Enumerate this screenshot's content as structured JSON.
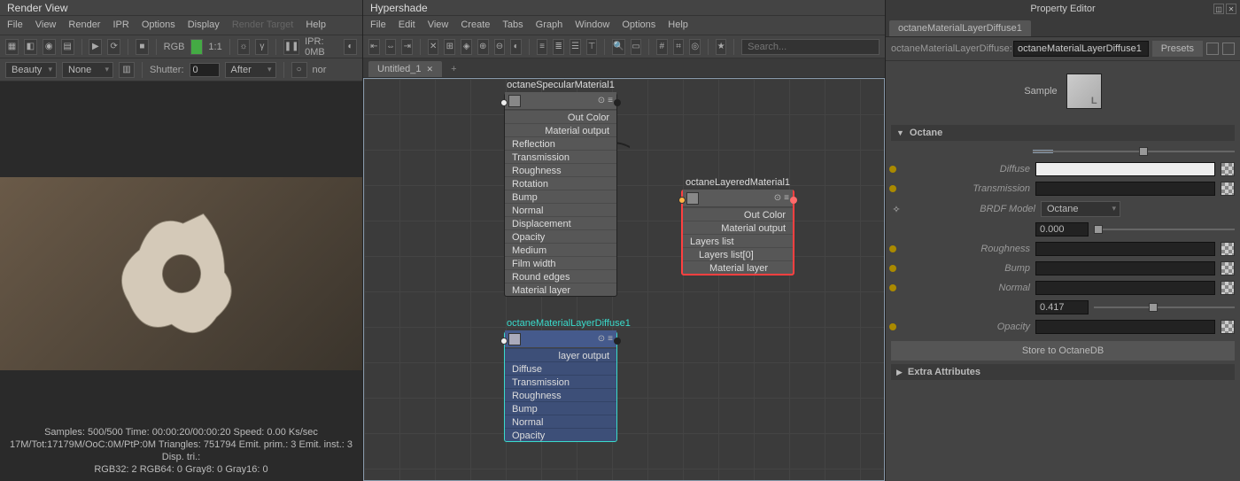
{
  "render_view": {
    "title": "Render View",
    "menu": [
      "File",
      "View",
      "Render",
      "IPR",
      "Options",
      "Display",
      "Render Target",
      "Help"
    ],
    "ipr_label": "IPR: 0MB",
    "rgb_label": "RGB",
    "ratio_label": "1:1",
    "row2": {
      "beauty": "Beauty",
      "none": "None",
      "shutter_label": "Shutter:",
      "shutter_val": "0",
      "after": "After",
      "nor": "nor"
    },
    "stats1": "Samples: 500/500 Time: 00:00:20/00:00:20 Speed: 0.00 Ks/sec",
    "stats2": "17M/Tot:17179M/OoC:0M/PtP:0M Triangles: 751794 Emit. prim.: 3 Emit. inst.: 3 Disp. tri.:",
    "stats3": "RGB32: 2 RGB64: 0 Gray8: 0 Gray16: 0"
  },
  "hypershade": {
    "title": "Hypershade",
    "menu": [
      "File",
      "Edit",
      "View",
      "Create",
      "Tabs",
      "Graph",
      "Window",
      "Options",
      "Help"
    ],
    "search_placeholder": "Search...",
    "tab": "Untitled_1",
    "nodes": {
      "specular": {
        "title": "octaneSpecularMaterial1",
        "out1": "Out Color",
        "out2": "Material output",
        "attrs": [
          "Reflection",
          "Transmission",
          "Roughness",
          "Rotation",
          "Bump",
          "Normal",
          "Displacement",
          "Opacity",
          "Medium",
          "Film width",
          "Round edges",
          "Material layer"
        ]
      },
      "layered": {
        "title": "octaneLayeredMaterial1",
        "out1": "Out Color",
        "out2": "Material output",
        "in1": "Layers list",
        "in2": "Layers list[0]",
        "in3": "Material layer"
      },
      "diffuse": {
        "title": "octaneMaterialLayerDiffuse1",
        "out1": "layer output",
        "attrs": [
          "Diffuse",
          "Transmission",
          "Roughness",
          "Bump",
          "Normal",
          "Opacity"
        ]
      }
    }
  },
  "props": {
    "panel_title": "Property Editor",
    "tab": "octaneMaterialLayerDiffuse1",
    "type_label": "octaneMaterialLayerDiffuse:",
    "name_value": "octaneMaterialLayerDiffuse1",
    "presets": "Presets",
    "sample": "Sample",
    "section_octane": "Octane",
    "rows": {
      "diffuse": "Diffuse",
      "transmission": "Transmission",
      "brdf": "BRDF Model",
      "brdf_value": "Octane",
      "roughness": "Roughness",
      "roughness_val": "0.000",
      "bump": "Bump",
      "normal": "Normal",
      "opacity": "Opacity",
      "opacity_val": "0.417"
    },
    "store_btn": "Store to OctaneDB",
    "section_extra": "Extra Attributes"
  }
}
